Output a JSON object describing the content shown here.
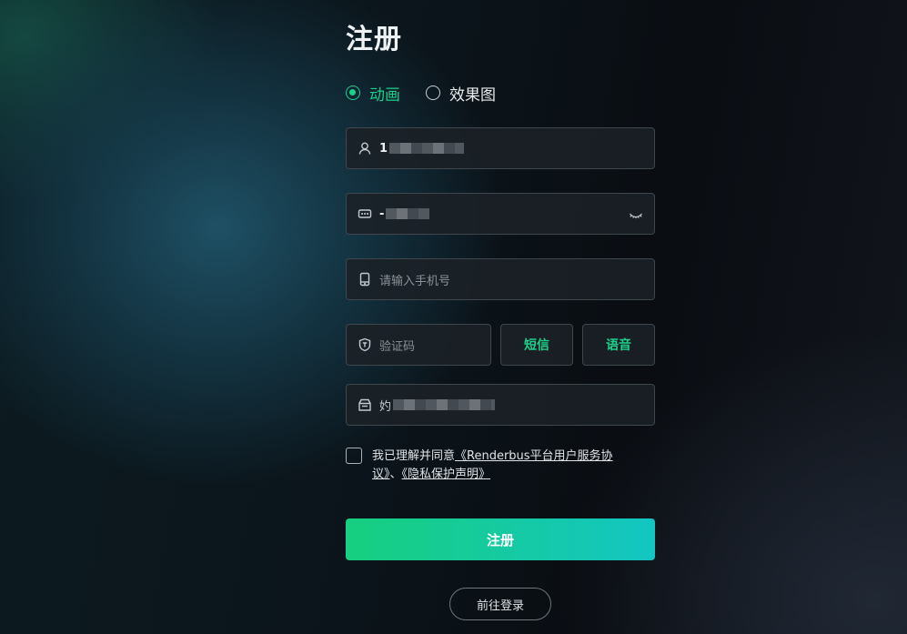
{
  "title": "注册",
  "type_options": [
    {
      "label": "动画",
      "selected": true
    },
    {
      "label": "效果图",
      "selected": false
    }
  ],
  "fields": {
    "username": {
      "value": "1",
      "masked": true
    },
    "password": {
      "value": "-",
      "masked": true
    },
    "phone": {
      "placeholder": "请输入手机号"
    },
    "code": {
      "placeholder": "验证码"
    },
    "email": {
      "value": "妁",
      "masked": true
    }
  },
  "buttons": {
    "sms": "短信",
    "voice": "语音",
    "submit": "注册",
    "login": "前往登录"
  },
  "agreement": {
    "prefix": "我已理解并同意",
    "service_link": "《Renderbus平台用户服务协议》",
    "separator": "、",
    "privacy_link": "《隐私保护声明》"
  },
  "colors": {
    "accent": "#1ccf8a",
    "submit_gradient_start": "#17cf7f",
    "submit_gradient_end": "#13c6c2"
  }
}
